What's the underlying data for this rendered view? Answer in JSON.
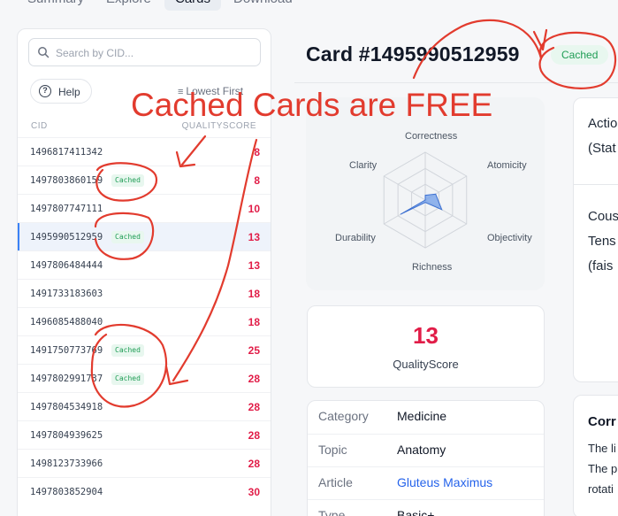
{
  "nav": {
    "tabs": [
      {
        "label": "Summary"
      },
      {
        "label": "Explore"
      },
      {
        "label": "Cards"
      },
      {
        "label": "Download"
      }
    ]
  },
  "sidebar": {
    "search_placeholder": "Search by CID...",
    "help_label": "Help",
    "sort_label": "Lowest First",
    "columns": {
      "cid": "CID",
      "score": "QUALITYSCORE"
    },
    "rows": [
      {
        "cid": "1496817411342",
        "score": "8"
      },
      {
        "cid": "1497803860159",
        "badge": "Cached",
        "score": "8"
      },
      {
        "cid": "1497807747111",
        "score": "10"
      },
      {
        "cid": "1495990512959",
        "badge": "Cached",
        "score": "13",
        "selected": true
      },
      {
        "cid": "1497806484444",
        "score": "13"
      },
      {
        "cid": "1491733183603",
        "score": "18"
      },
      {
        "cid": "1496085488040",
        "score": "18"
      },
      {
        "cid": "1491750773769",
        "badge": "Cached",
        "score": "25"
      },
      {
        "cid": "1497802991737",
        "badge": "Cached",
        "score": "28"
      },
      {
        "cid": "1497804534918",
        "score": "28"
      },
      {
        "cid": "1497804939625",
        "score": "28"
      },
      {
        "cid": "1498123733966",
        "score": "28"
      },
      {
        "cid": "1497803852904",
        "score": "30"
      }
    ]
  },
  "card": {
    "title": "Card #1495990512959",
    "status_badge": "Cached",
    "radar": {
      "axes": [
        "Correctness",
        "Atomicity",
        "Objectivity",
        "Richness",
        "Durability",
        "Clarity"
      ],
      "values": [
        0.1,
        0.25,
        0.4,
        0.05,
        0.6,
        0.0
      ]
    },
    "quality_score": "13",
    "quality_label": "QualityScore",
    "meta": [
      {
        "key": "Category",
        "value": "Medicine"
      },
      {
        "key": "Topic",
        "value": "Anatomy"
      },
      {
        "key": "Article",
        "value": "Gluteus Maximus",
        "link": true
      },
      {
        "key": "Type",
        "value": "Basic+"
      }
    ]
  },
  "right_panel": {
    "line1": "Actio",
    "line2": "(Stat",
    "line3": "Cous",
    "line4": "Tens",
    "line5": "(fais",
    "bottom_title": "Corr",
    "bottom_line1": "The li",
    "bottom_line2": "The p",
    "bottom_line3": "rotati"
  },
  "annotation": {
    "text": "Cached Cards are FREE",
    "color": "#e23b2e"
  }
}
